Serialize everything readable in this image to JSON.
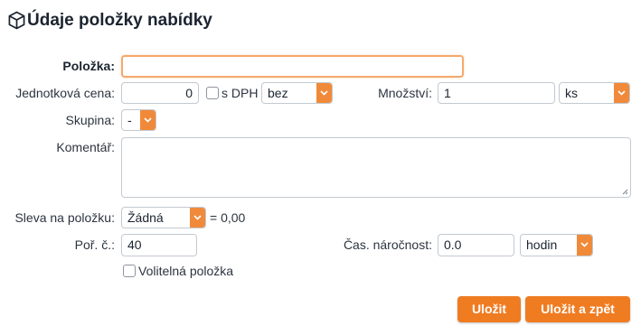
{
  "header": {
    "title": "Údaje položky nabídky",
    "icon": "cube-icon"
  },
  "form": {
    "item": {
      "label": "Položka:",
      "value": ""
    },
    "unit_price": {
      "label": "Jednotková cena:",
      "value": "0",
      "vat_label": "s DPH",
      "vat_checked": false,
      "vat_select": "bez"
    },
    "quantity": {
      "label": "Množství:",
      "value": "1",
      "unit_select": "ks"
    },
    "group": {
      "label": "Skupina:",
      "select": "-"
    },
    "comment": {
      "label": "Komentář:",
      "value": ""
    },
    "discount": {
      "label": "Sleva na položku:",
      "select": "Žádná",
      "result": "= 0,00"
    },
    "order_no": {
      "label": "Poř. č.:",
      "value": "40"
    },
    "time": {
      "label": "Čas. náročnost:",
      "value": "0.0",
      "unit_select": "hodin"
    },
    "optional": {
      "label": "Volitelná položka",
      "checked": false
    }
  },
  "actions": {
    "save": "Uložit",
    "save_back": "Uložit a zpět"
  },
  "colors": {
    "accent": "#f07c22",
    "focus_border": "#f5a86b",
    "text": "#1b2430"
  }
}
